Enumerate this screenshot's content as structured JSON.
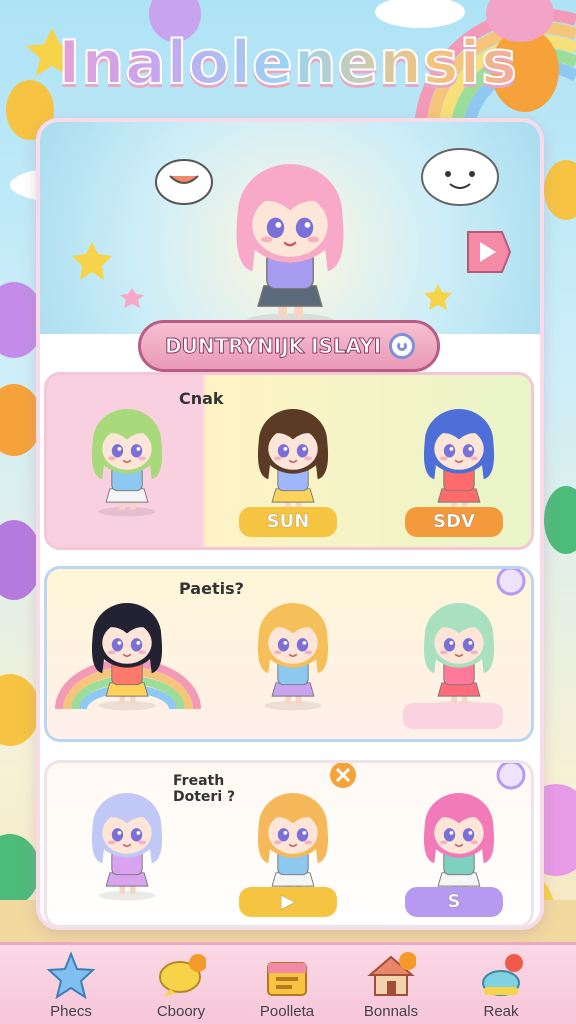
{
  "app": {
    "title": "Inalolenensis"
  },
  "banner": {
    "label": "DUNTRYNIJK ISLAYI"
  },
  "cards": [
    {
      "caption": "Cnak",
      "characters": [
        {
          "hair": "#a8d97a",
          "top": "#8cc8f0",
          "skirt": "#f5f5f5"
        },
        {
          "hair": "#5b3a26",
          "top": "#9fb7ff",
          "skirt": "#ffd35a",
          "pill": "SUN",
          "pill_color": "#f5c542"
        },
        {
          "hair": "#4f6fd8",
          "top": "#ff6b6b",
          "skirt": "#ff6b6b",
          "pill": "SDV",
          "pill_color": "#f39a3c"
        }
      ]
    },
    {
      "caption": "Paetis?",
      "characters": [
        {
          "hair": "#222233",
          "top": "#ff7a6a",
          "skirt": "#ffd35a"
        },
        {
          "hair": "#f5c05a",
          "top": "#8cc8f0",
          "skirt": "#c9a3ef"
        },
        {
          "hair": "#a8e0c0",
          "top": "#ff7a9a",
          "skirt": "#ff6b7a"
        }
      ]
    },
    {
      "caption": "Freath Doteri ?",
      "characters": [
        {
          "hair": "#c0c8f5",
          "top": "#d9a3f0",
          "skirt": "#d9a3f0"
        },
        {
          "hair": "#f5b85a",
          "top": "#8cc8f0",
          "skirt": "#f5f5f5",
          "pill": "▶",
          "pill_color": "#f5c542"
        },
        {
          "hair": "#f27ab8",
          "top": "#7fd0c0",
          "skirt": "#f5f5f5",
          "pill": "S",
          "pill_color": "#b69af0"
        }
      ]
    }
  ],
  "hero": {
    "hair": "#f7a9c7",
    "top": "#a79cf0",
    "skirt": "#5a6a7a"
  },
  "nav": [
    {
      "label": "Phecs",
      "icon": "star-icon"
    },
    {
      "label": "Cboory",
      "icon": "chat-icon"
    },
    {
      "label": "Poolleta",
      "icon": "box-icon"
    },
    {
      "label": "Bonnals",
      "icon": "house-icon"
    },
    {
      "label": "Reak",
      "icon": "bell-icon"
    }
  ]
}
